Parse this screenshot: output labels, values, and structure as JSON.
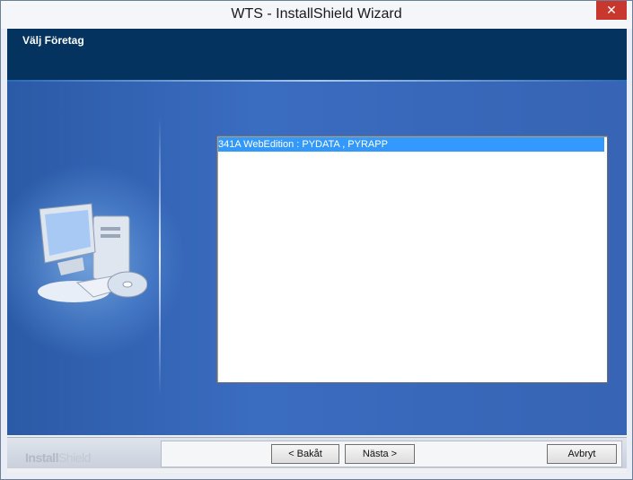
{
  "window": {
    "title": "WTS - InstallShield Wizard",
    "close_glyph": "✕"
  },
  "header": {
    "title": "Välj Företag"
  },
  "list": {
    "items": [
      "341A WebEdition : PYDATA , PYRAPP"
    ],
    "selected_index": 0
  },
  "footer": {
    "brand_primary": "Install",
    "brand_secondary": "Shield",
    "back_label": "< Bakåt",
    "next_label": "Nästa >",
    "cancel_label": "Avbryt"
  },
  "colors": {
    "header_bg": "#03335e",
    "body_bg": "#3a6cc0",
    "selection": "#3399ff",
    "close": "#c7372d"
  },
  "icons": [
    "close-icon",
    "computer-illustration",
    "cd-icon"
  ]
}
